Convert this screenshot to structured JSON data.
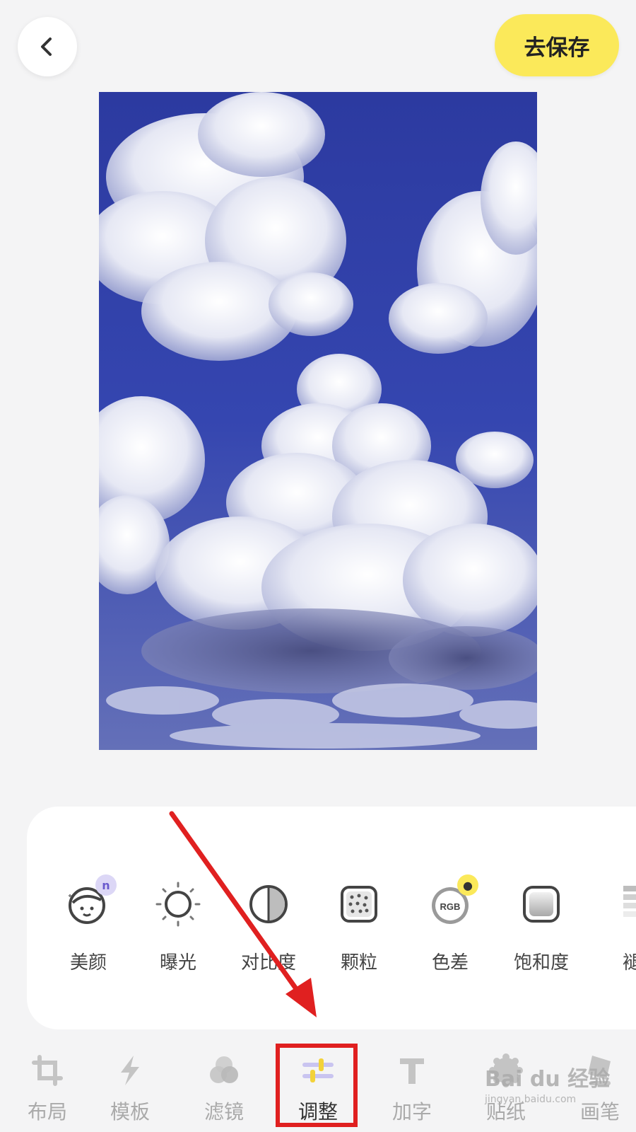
{
  "header": {
    "back_icon": "chevron-left-icon",
    "save_label": "去保存",
    "save_color": "#fbe95a"
  },
  "canvas": {
    "photo_subject": "blue sky with cumulus clouds"
  },
  "adjust_tools": [
    {
      "label": "美颜",
      "icon": "face-beauty-icon",
      "badge": "n"
    },
    {
      "label": "曝光",
      "icon": "sun-icon"
    },
    {
      "label": "对比度",
      "icon": "contrast-icon"
    },
    {
      "label": "颗粒",
      "icon": "grain-icon"
    },
    {
      "label": "色差",
      "icon": "rgb-icon",
      "badge": "lock"
    },
    {
      "label": "饱和度",
      "icon": "saturation-icon"
    },
    {
      "label": "褪",
      "icon": "fade-icon"
    }
  ],
  "bottom_nav": [
    {
      "label": "布局",
      "icon": "crop-icon"
    },
    {
      "label": "模板",
      "icon": "lightning-icon"
    },
    {
      "label": "滤镜",
      "icon": "filter-circles-icon"
    },
    {
      "label": "调整",
      "icon": "sliders-icon",
      "active": true
    },
    {
      "label": "加字",
      "icon": "text-icon"
    },
    {
      "label": "贴纸",
      "icon": "sticker-icon"
    },
    {
      "label": "画笔",
      "icon": "brush-icon"
    }
  ],
  "annotation": {
    "arrow_color": "#e02020"
  },
  "watermark": {
    "text": "Bai du 经验",
    "url": "jingyan.baidu.com"
  }
}
